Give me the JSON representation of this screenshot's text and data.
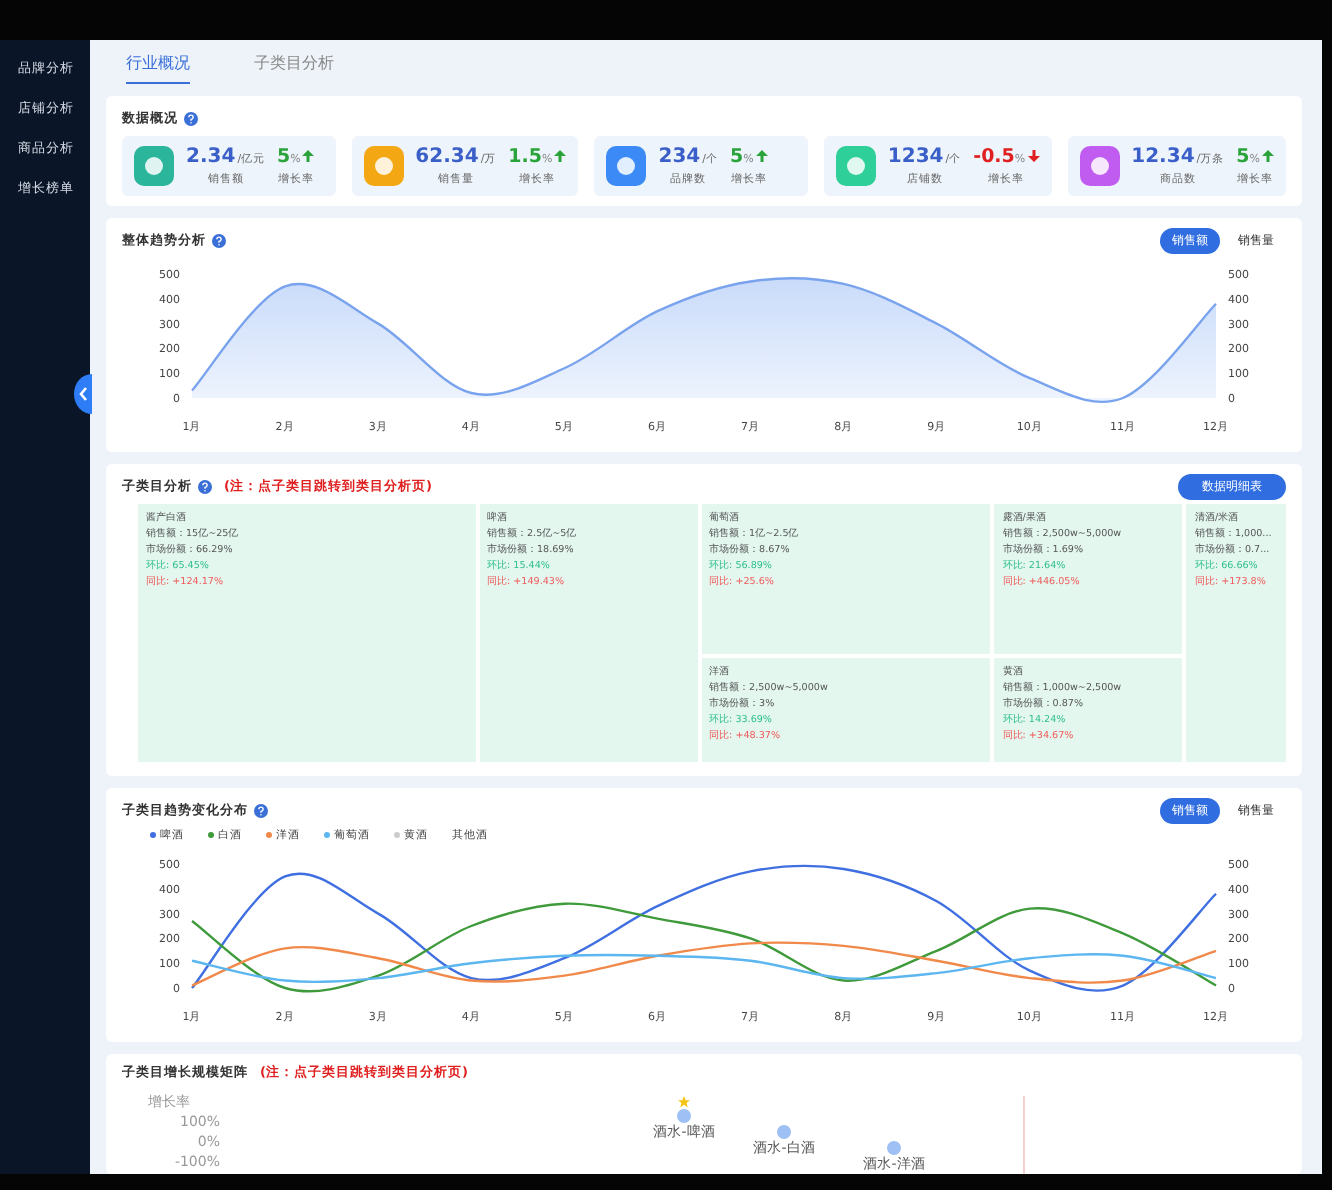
{
  "sidebar": {
    "items": [
      {
        "label": "品牌分析",
        "selected": false
      },
      {
        "label": "店铺分析",
        "selected": false
      },
      {
        "label": "商品分析",
        "selected": false
      },
      {
        "label": "增长榜单",
        "selected": false
      }
    ]
  },
  "tabs": [
    {
      "label": "行业概况",
      "selected": true
    },
    {
      "label": "子类目分析",
      "selected": false
    }
  ],
  "overview": {
    "title": "数据概况",
    "stats": [
      {
        "value": "2.34",
        "unit": "/亿元",
        "label": "销售额",
        "rate": "5",
        "rate_unit": "%",
        "rate_label": "增长率",
        "color": "#2bb59a"
      },
      {
        "value": "62.34",
        "unit": "/万",
        "label": "销售量",
        "rate": "1.5",
        "rate_unit": "%",
        "rate_label": "增长率",
        "color": "#f3a712"
      },
      {
        "value": "234",
        "unit": "/个",
        "label": "品牌数",
        "rate": "5",
        "rate_unit": "%",
        "rate_label": "增长率",
        "color": "#3b8af5"
      },
      {
        "value": "1234",
        "unit": "/个",
        "label": "店铺数",
        "rate": "-0.5",
        "rate_unit": "%",
        "rate_label": "增长率",
        "color": "#2fcf9a"
      },
      {
        "value": "12.34",
        "unit": "/万条",
        "label": "商品数",
        "rate": "5",
        "rate_unit": "%",
        "rate_label": "增长率",
        "color": "#c05cf0"
      }
    ]
  },
  "trend": {
    "title": "整体趋势分析",
    "toggles": [
      {
        "label": "销售额",
        "selected": true
      },
      {
        "label": "销售量",
        "selected": false
      }
    ],
    "right_axis": [
      "500",
      "400",
      "300",
      "200",
      "100",
      "0"
    ],
    "chart_data": {
      "type": "area",
      "categories": [
        "1月",
        "2月",
        "3月",
        "4月",
        "5月",
        "6月",
        "7月",
        "8月",
        "9月",
        "10月",
        "11月",
        "12月"
      ],
      "yticks": [
        0,
        100,
        200,
        300,
        400,
        500
      ],
      "ylim": [
        0,
        500
      ],
      "series": [
        {
          "color": "#7aa3ee",
          "values": [
            30,
            450,
            300,
            20,
            120,
            350,
            470,
            460,
            300,
            80,
            0,
            380
          ]
        }
      ]
    }
  },
  "subcategory": {
    "title": "子类目分析",
    "note": "(注：点子类目跳转到类目分析页)",
    "button": "数据明细表",
    "cells": [
      {
        "name": "酱产白酒",
        "lines": [
          "销售额：15亿~25亿",
          "市场份额：66.29%"
        ],
        "mom": "环比: 65.45%",
        "yoy": "同比: +124.17%"
      },
      {
        "name": "啤酒",
        "lines": [
          "销售额：2.5亿~5亿",
          "市场份额：18.69%"
        ],
        "mom": "环比: 15.44%",
        "yoy": "同比: +149.43%"
      },
      {
        "name": "葡萄酒",
        "lines": [
          "销售额：1亿~2.5亿",
          "市场份额：8.67%"
        ],
        "mom": "环比: 56.89%",
        "yoy": "同比: +25.6%"
      },
      {
        "name": "洋酒",
        "lines": [
          "销售额：2,500w~5,000w",
          "市场份额：3%"
        ],
        "mom": "环比: 33.69%",
        "yoy": "同比: +48.37%"
      },
      {
        "name": "露酒/果酒",
        "lines": [
          "销售额：2,500w~5,000w",
          "市场份额：1.69%"
        ],
        "mom": "环比: 21.64%",
        "yoy": "同比: +446.05%"
      },
      {
        "name": "黄酒",
        "lines": [
          "销售额：1,000w~2,500w",
          "市场份额：0.87%"
        ],
        "mom": "环比: 14.24%",
        "yoy": "同比: +34.67%"
      },
      {
        "name": "清酒/米酒",
        "lines": [
          "销售额：1,000...",
          "市场份额：0.7..."
        ],
        "mom": "环比: 66.66%",
        "yoy": "同比: +173.8%"
      }
    ]
  },
  "distribution": {
    "title": "子类目趋势变化分布",
    "toggles": [
      {
        "label": "销售额",
        "selected": true
      },
      {
        "label": "销售量",
        "selected": false
      }
    ],
    "right_axis": [
      "500",
      "400",
      "300",
      "200",
      "100",
      "0"
    ],
    "chart_data": {
      "type": "line",
      "categories": [
        "1月",
        "2月",
        "3月",
        "4月",
        "5月",
        "6月",
        "7月",
        "8月",
        "9月",
        "10月",
        "11月",
        "12月"
      ],
      "yticks": [
        0,
        100,
        200,
        300,
        400,
        500
      ],
      "ylim": [
        0,
        500
      ],
      "series": [
        {
          "name": "啤酒",
          "color": "#3f6fe0",
          "values": [
            0,
            450,
            300,
            40,
            120,
            330,
            470,
            480,
            350,
            70,
            10,
            380
          ]
        },
        {
          "name": "白酒",
          "color": "#3e9a3a",
          "values": [
            270,
            0,
            50,
            250,
            340,
            280,
            200,
            30,
            150,
            320,
            220,
            10
          ]
        },
        {
          "name": "洋酒",
          "color": "#f0894a",
          "values": [
            10,
            160,
            120,
            30,
            50,
            130,
            180,
            170,
            110,
            40,
            30,
            150
          ]
        },
        {
          "name": "葡萄酒",
          "color": "#5cb6f0",
          "values": [
            110,
            30,
            40,
            100,
            130,
            130,
            110,
            40,
            60,
            120,
            130,
            40
          ]
        },
        {
          "name": "黄酒",
          "color": "#cccccc",
          "values": [
            null,
            null,
            null,
            null,
            null,
            null,
            null,
            null,
            null,
            null,
            null,
            null
          ]
        },
        {
          "name": "其他酒",
          "values": [
            null,
            null,
            null,
            null,
            null,
            null,
            null,
            null,
            null,
            null,
            null,
            null
          ]
        }
      ]
    }
  },
  "matrix": {
    "title": "子类目增长规模矩阵",
    "note": "(注：点子类目跳转到类目分析页)",
    "axis_title": "增长率",
    "axis_labels": [
      "100%",
      "0%",
      "-100%"
    ],
    "points": [
      {
        "label": "酒水-啤酒",
        "starred": true
      },
      {
        "label": "酒水-白酒",
        "starred": false
      },
      {
        "label": "酒水-洋酒",
        "starred": false
      }
    ]
  }
}
